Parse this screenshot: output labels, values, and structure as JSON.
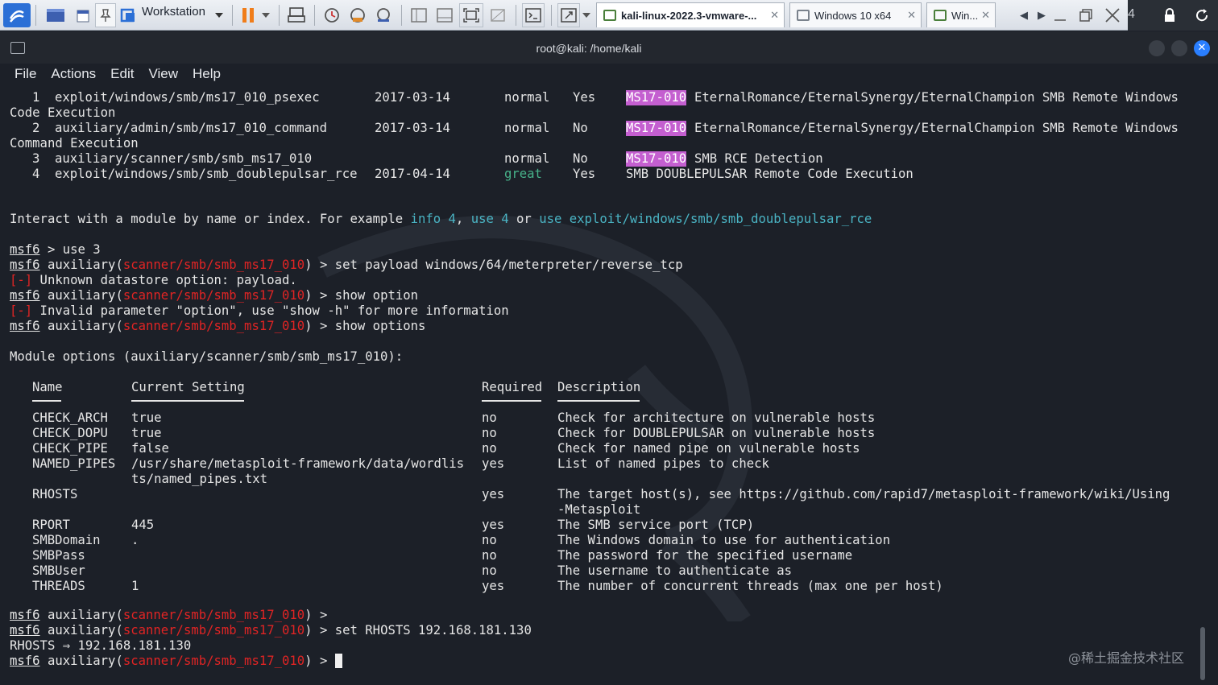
{
  "vmware": {
    "workstation_label": "Workstation",
    "tabs": [
      {
        "label": "kali-linux-2022.3-vmware-..."
      },
      {
        "label": "Windows 10 x64"
      },
      {
        "label": "Win..."
      }
    ],
    "edge_text": "4"
  },
  "window": {
    "title": "root@kali: /home/kali"
  },
  "menu": {
    "file": "File",
    "actions": "Actions",
    "edit": "Edit",
    "view": "View",
    "help": "Help"
  },
  "search_results": [
    {
      "idx": "1",
      "name": "exploit/windows/smb/ms17_010_psexec",
      "date": "2017-03-14",
      "rank": "normal",
      "check": "Yes",
      "tag": "MS17-010",
      "desc": "EternalRomance/EternalSynergy/EternalChampion SMB Remote Windows",
      "desc2": "Code Execution"
    },
    {
      "idx": "2",
      "name": "auxiliary/admin/smb/ms17_010_command",
      "date": "2017-03-14",
      "rank": "normal",
      "check": "No",
      "tag": "MS17-010",
      "desc": "EternalRomance/EternalSynergy/EternalChampion SMB Remote Windows",
      "desc2": "Command Execution"
    },
    {
      "idx": "3",
      "name": "auxiliary/scanner/smb/smb_ms17_010",
      "date": "",
      "rank": "normal",
      "check": "No",
      "tag": "MS17-010",
      "desc": "SMB RCE Detection"
    },
    {
      "idx": "4",
      "name": "exploit/windows/smb/smb_doublepulsar_rce",
      "date": "2017-04-14",
      "rank": "great",
      "check": "Yes",
      "tag": "",
      "desc": "SMB DOUBLEPULSAR Remote Code Execution"
    }
  ],
  "interact": {
    "prefix": "Interact with a module by name or index. For example ",
    "info": "info 4",
    "comma": ", ",
    "use4": "use 4",
    "or": " or ",
    "use_full": "use exploit/windows/smb/smb_doublepulsar_rce"
  },
  "prompt": {
    "msf": "msf6",
    "aux_open": " auxiliary(",
    "module": "scanner/smb/smb_ms17_010",
    "aux_close": ") > ",
    "plain": " > "
  },
  "session": {
    "cmd_use": "use 3",
    "cmd_set_payload": "set payload windows/64/meterpreter/reverse_tcp",
    "err_mark": "[-]",
    "err1": " Unknown datastore option: payload.",
    "cmd_show_option": "show option",
    "err2": " Invalid parameter \"option\", use \"show -h\" for more information",
    "cmd_show_options": "show options",
    "module_options": "Module options (auxiliary/scanner/smb/smb_ms17_010):",
    "cmd_set_rhosts": "set RHOSTS 192.168.181.130",
    "rhosts_result": "RHOSTS ⇒ 192.168.181.130"
  },
  "options_table": {
    "headers": {
      "name": "Name",
      "setting": "Current Setting",
      "required": "Required",
      "description": "Description"
    },
    "rows": [
      {
        "name": "CHECK_ARCH",
        "setting": "true",
        "required": "no",
        "description": "Check for architecture on vulnerable hosts"
      },
      {
        "name": "CHECK_DOPU",
        "setting": "true",
        "required": "no",
        "description": "Check for DOUBLEPULSAR on vulnerable hosts"
      },
      {
        "name": "CHECK_PIPE",
        "setting": "false",
        "required": "no",
        "description": "Check for named pipe on vulnerable hosts"
      },
      {
        "name": "NAMED_PIPES",
        "setting": "/usr/share/metasploit-framework/data/wordlis",
        "setting2": "ts/named_pipes.txt",
        "required": "yes",
        "description": "List of named pipes to check"
      },
      {
        "name": "RHOSTS",
        "setting": "",
        "required": "yes",
        "description": "The target host(s), see https://github.com/rapid7/metasploit-framework/wiki/Using",
        "description2": "-Metasploit"
      },
      {
        "name": "RPORT",
        "setting": "445",
        "required": "yes",
        "description": "The SMB service port (TCP)"
      },
      {
        "name": "SMBDomain",
        "setting": ".",
        "required": "no",
        "description": "The Windows domain to use for authentication"
      },
      {
        "name": "SMBPass",
        "setting": "",
        "required": "no",
        "description": "The password for the specified username"
      },
      {
        "name": "SMBUser",
        "setting": "",
        "required": "no",
        "description": "The username to authenticate as"
      },
      {
        "name": "THREADS",
        "setting": "1",
        "required": "yes",
        "description": "The number of concurrent threads (max one per host)"
      }
    ]
  },
  "watermark": "@稀土掘金技术社区",
  "colors": {
    "terminal_bg": "#1c2028",
    "prompt_module_red": "#e02424",
    "tag_highlight": "#c45fd0",
    "rank_great_green": "#47b28a",
    "interact_cyan": "#4ab4c4",
    "close_button_blue": "#2a7fff"
  },
  "icons": [
    "vmware-logo-icon",
    "pin-icon",
    "pause-icon",
    "snapshot-icon",
    "terminal-icon",
    "close-icon",
    "lock-icon",
    "chevron-down-icon"
  ]
}
